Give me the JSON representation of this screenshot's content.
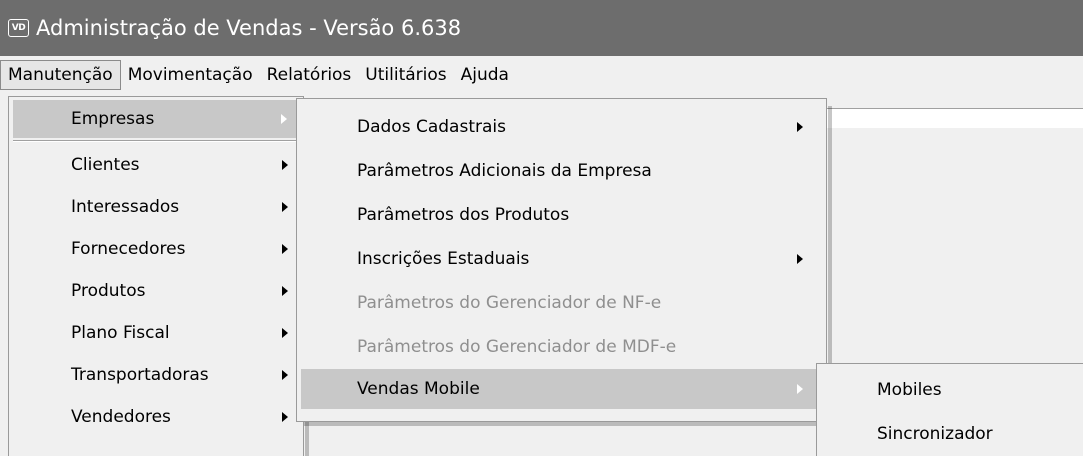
{
  "window": {
    "icon_text": "VD",
    "title": "Administração de Vendas - Versão 6.638"
  },
  "menubar": {
    "items": [
      "Manutenção",
      "Movimentação",
      "Relatórios",
      "Utilitários",
      "Ajuda"
    ]
  },
  "menu_manutencao": {
    "items": [
      {
        "label": "Empresas",
        "submenu": true,
        "highlighted": true
      },
      {
        "label": "Clientes",
        "submenu": true
      },
      {
        "label": "Interessados",
        "submenu": true
      },
      {
        "label": "Fornecedores",
        "submenu": true
      },
      {
        "label": "Produtos",
        "submenu": true
      },
      {
        "label": "Plano Fiscal",
        "submenu": true
      },
      {
        "label": "Transportadoras",
        "submenu": true
      },
      {
        "label": "Vendedores",
        "submenu": true
      }
    ]
  },
  "menu_empresas": {
    "items": [
      {
        "label": "Dados Cadastrais",
        "submenu": true
      },
      {
        "label": "Parâmetros Adicionais da Empresa"
      },
      {
        "label": "Parâmetros dos Produtos"
      },
      {
        "label": "Inscrições Estaduais",
        "submenu": true
      },
      {
        "label": "Parâmetros do Gerenciador de NF-e",
        "disabled": true
      },
      {
        "label": "Parâmetros do Gerenciador de MDF-e",
        "disabled": true
      },
      {
        "label": "Vendas Mobile",
        "submenu": true,
        "highlighted": true
      }
    ]
  },
  "menu_vendas_mobile": {
    "items": [
      {
        "label": "Mobiles"
      },
      {
        "label": "Sincronizador"
      }
    ]
  },
  "colors": {
    "titlebar": "#6d6d6d",
    "menu_bg": "#f0f0f0",
    "highlight": "#c8c8c8",
    "disabled_text": "#8f8f8f"
  }
}
